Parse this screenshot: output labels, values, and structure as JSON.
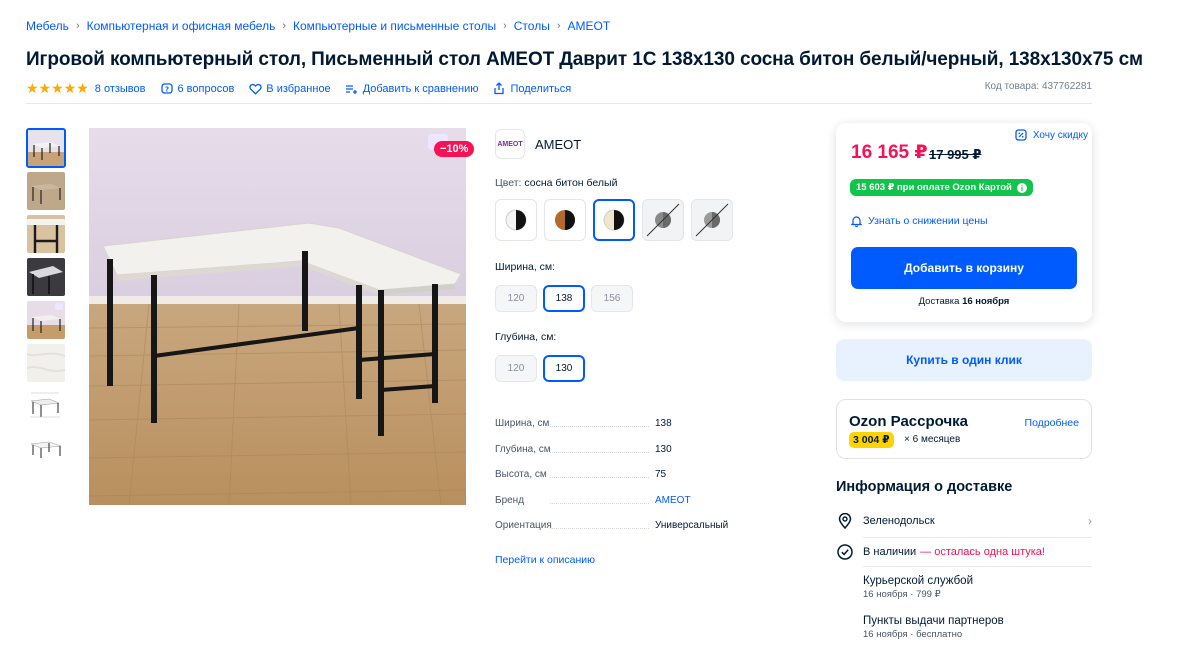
{
  "breadcrumb": [
    "Мебель",
    "Компьютерная и офисная мебель",
    "Компьютерные и письменные столы",
    "Столы",
    "AMEOT"
  ],
  "title": "Игровой компьютерный стол, Письменный стол AMEOT Даврит 1С 138х130 сосна битон белый/черный, 138х130х75 см",
  "meta": {
    "rating_stars": "★★★★★",
    "reviews": "8 отзывов",
    "questions": "6 вопросов",
    "favorite": "В избранное",
    "compare": "Добавить к сравнению",
    "share": "Поделиться",
    "product_code": "Код товара: 437762281"
  },
  "photo": {
    "discount": "−10%"
  },
  "brand": {
    "logo_text": "AMEOT",
    "name": "AMEOT"
  },
  "color": {
    "label": "Цвет:",
    "value": "сосна битон белый",
    "swatches": [
      {
        "name": "white-black",
        "available": true,
        "selected": false
      },
      {
        "name": "wood-black",
        "available": true,
        "selected": false
      },
      {
        "name": "cream-black",
        "available": true,
        "selected": true
      },
      {
        "name": "grey-unavailable",
        "available": false,
        "selected": false
      },
      {
        "name": "grey-unavailable-2",
        "available": false,
        "selected": false
      }
    ]
  },
  "width": {
    "label": "Ширина, см:",
    "options": [
      "120",
      "138",
      "156"
    ],
    "selected": "138"
  },
  "depth": {
    "label": "Глубина, см:",
    "options": [
      "120",
      "130"
    ],
    "selected": "130"
  },
  "specs": [
    {
      "key": "Ширина, см",
      "value": "138"
    },
    {
      "key": "Глубина, см",
      "value": "130"
    },
    {
      "key": "Высота, см",
      "value": "75"
    },
    {
      "key": "Бренд",
      "value": "AMEOT"
    },
    {
      "key": "Ориентация",
      "value": "Универсальный"
    }
  ],
  "to_description": "Перейти к описанию",
  "price": {
    "current": "16 165 ₽",
    "old": "17 995 ₽",
    "want_discount": "Хочу скидку",
    "card_price": "15 603 ₽ при оплате Ozon Картой",
    "notify": "Узнать о снижении цены",
    "add_to_cart": "Добавить в корзину",
    "delivery_prefix": "Доставка",
    "delivery_date": "16 ноября"
  },
  "one_click": "Купить в один клик",
  "installment": {
    "title": "Ozon Рассрочка",
    "more": "Подробнее",
    "monthly": "3 004 ₽",
    "months": "× 6 месяцев"
  },
  "delivery": {
    "title": "Информация о доставке",
    "city": "Зеленодольск",
    "stock": "В наличии",
    "stock_note": "— осталась одна штука!",
    "options": [
      {
        "title": "Курьерской службой",
        "subtitle": "16 ноября · 799 ₽"
      },
      {
        "title": "Пункты выдачи партнеров",
        "subtitle": "16 ноября · бесплатно"
      }
    ]
  },
  "colors": {
    "accent": "#005bff",
    "sale": "#f91155",
    "card_green": "#10c44c",
    "installment_yellow": "#ffd300",
    "stars": "#ffa800"
  }
}
